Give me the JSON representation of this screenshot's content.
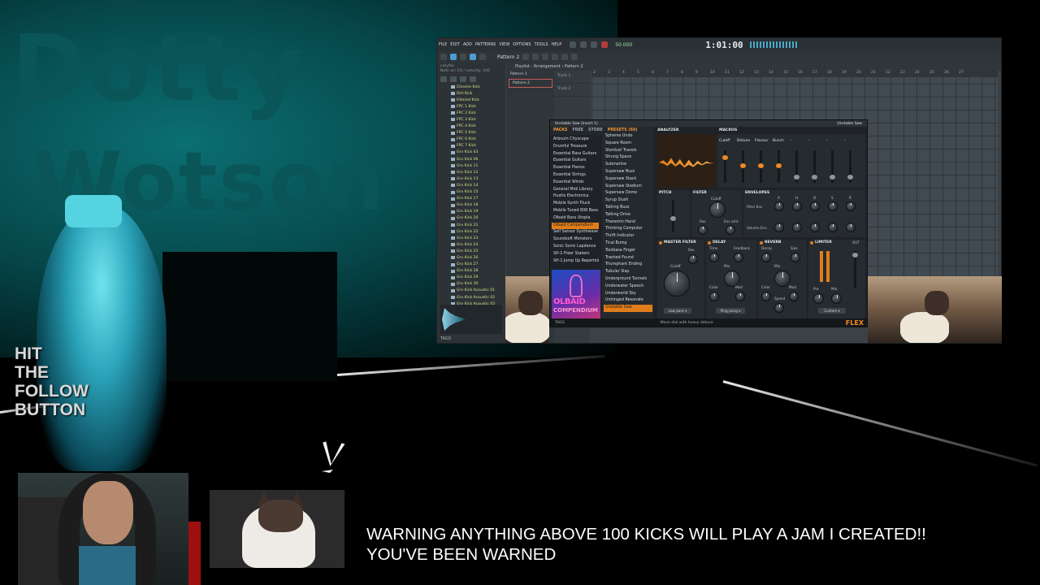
{
  "overlay": {
    "title_line1": "Dotty",
    "title_line2": "Wotson",
    "follow_lines": [
      "HIT",
      "THE",
      "FOLLOW",
      "BUTTON"
    ],
    "warning_line1": "WARNING ANYTHING ABOVE 100 KICKS WILL PLAY A JAM I CREATED!!",
    "warning_line2": "YOU'VE BEEN WARNED"
  },
  "daw": {
    "menu": [
      "FILE",
      "EDIT",
      "ADD",
      "PATTERNS",
      "VIEW",
      "OPTIONS",
      "TOOLS",
      "HELP"
    ],
    "tempo": "50.000",
    "time": "1:01:00",
    "pattern": "Pattern 2",
    "browser": {
      "hint_line1": "cutyfox",
      "hint_line2": "Note on: E4 / velocity: 100",
      "items": [
        "Chrome Kick",
        "Dirt Kick",
        "Filtered Kick",
        "FPC 1 Kick",
        "FPC 2 Kick",
        "FPC 3 Kick",
        "FPC 4 Kick",
        "FPC 5 Kick",
        "FPC 6 Kick",
        "FPC 7 Kick",
        "Grv Kick 03",
        "Grv Kick 06",
        "Grv Kick 11",
        "Grv Kick 12",
        "Grv Kick 13",
        "Grv Kick 14",
        "Grv Kick 15",
        "Grv Kick 17",
        "Grv Kick 18",
        "Grv Kick 19",
        "Grv Kick 20",
        "Grv Kick 21",
        "Grv Kick 22",
        "Grv Kick 23",
        "Grv Kick 24",
        "Grv Kick 25",
        "Grv Kick 26",
        "Grv Kick 27",
        "Grv Kick 28",
        "Grv Kick 29",
        "Grv Kick 30",
        "Grv Kick Acoustic 01",
        "Grv Kick Acoustic 02",
        "Grv Kick Acoustic 03"
      ],
      "tags": "TAGS"
    },
    "playlist": {
      "header": "Playlist - Arrangement › Pattern 2",
      "patterns": [
        "Pattern 1",
        "Pattern 2"
      ],
      "tracks": [
        "Track 1",
        "Track 2"
      ],
      "ruler": [
        "2",
        "3",
        "4",
        "5",
        "6",
        "7",
        "8",
        "9",
        "10",
        "11",
        "12",
        "13",
        "14",
        "15",
        "16",
        "17",
        "18",
        "19",
        "20",
        "21",
        "22",
        "23",
        "24",
        "25",
        "26",
        "27"
      ]
    }
  },
  "flex": {
    "title_left": "Unstable Saw (Insert 1)",
    "title_right": "Unstable Saw",
    "tabs": {
      "packs": "PACKS",
      "free": "FREE",
      "store": "STORE",
      "presets": "PRESETS (60)"
    },
    "packs": [
      "Arbouln Cityscape",
      "Drumful Treasure",
      "Essential Bass Guitars",
      "Essential Guitars",
      "Essential Pianos",
      "Essential Strings",
      "Essential Winds",
      "General Midi Library",
      "Hustle Electronica",
      "Mobile Synth Pluck",
      "Mobile Tuned 808 Bass",
      "Olbaid Bass Utopia",
      "Olbaid Compendium",
      "Self Sensor Synthwave",
      "Soundsoft Monsters",
      "Sonic Sonic Lapdance",
      "SH-1 Freer Stakers",
      "SH-1 Jump Up Repertoire"
    ],
    "selected_pack": "Olbaid Compendium",
    "presets": [
      "Spheres Undo",
      "Square Room",
      "Stardust Travels",
      "Strung Space",
      "Submarine",
      "Supersaw Buzz",
      "Supersaw Stack",
      "Supersaw Stadium",
      "Supersaw Dome",
      "Syrup Slush",
      "Talking Buzz",
      "Talking Drive",
      "Theremin Hand",
      "Thinking Computer",
      "Thrift Indicator",
      "Tical Bump",
      "Toolbase Finger",
      "Trashed Found",
      "Triumphant Ending",
      "Tubular Slap",
      "Underground Tunnels",
      "Underwater Speech",
      "Underworld Sky",
      "Unhinged Resonate",
      "Unstable Saw"
    ],
    "selected_preset": "Unstable Saw",
    "cover_line1": "OLBAID",
    "cover_line2": "COMPENDIUM",
    "analyzer_label": "ANALYZER",
    "macros_label": "MACROS",
    "macro_names": [
      "Cutoff",
      "Detune",
      "Flavour",
      "Bunch",
      "-",
      "-",
      "-",
      "-"
    ],
    "pitch_label": "PITCH",
    "filter_label": "FILTER",
    "filter_knobs": [
      "Cutoff",
      "Res",
      "Env amt"
    ],
    "envelopes_label": "ENVELOPES",
    "env_rows": [
      "Filter Env",
      "Volume Env"
    ],
    "env_cols": [
      "A",
      "H",
      "D",
      "S",
      "R"
    ],
    "master_filter_label": "MASTER FILTER",
    "delay_label": "DELAY",
    "reverb_label": "REVERB",
    "limiter_label": "LIMITER",
    "out_label": "OUT",
    "mf_knobs": [
      "Res",
      "Cutoff"
    ],
    "mf_mode": "Low pass ▾",
    "delay_knobs": [
      "Time",
      "Feedback",
      "Mix",
      "Color",
      "Mod"
    ],
    "delay_mode": "Ping-pong ▾",
    "reverb_knobs": [
      "Decay",
      "Size",
      "Mix",
      "Color",
      "Mod",
      "Speed"
    ],
    "limiter_knobs": [
      "Pre",
      "Mix"
    ],
    "limiter_mode": "Custom ▾",
    "footer_hint": "Move dial with heavy detune",
    "tags": "TAGS",
    "brand": "FLEX"
  }
}
